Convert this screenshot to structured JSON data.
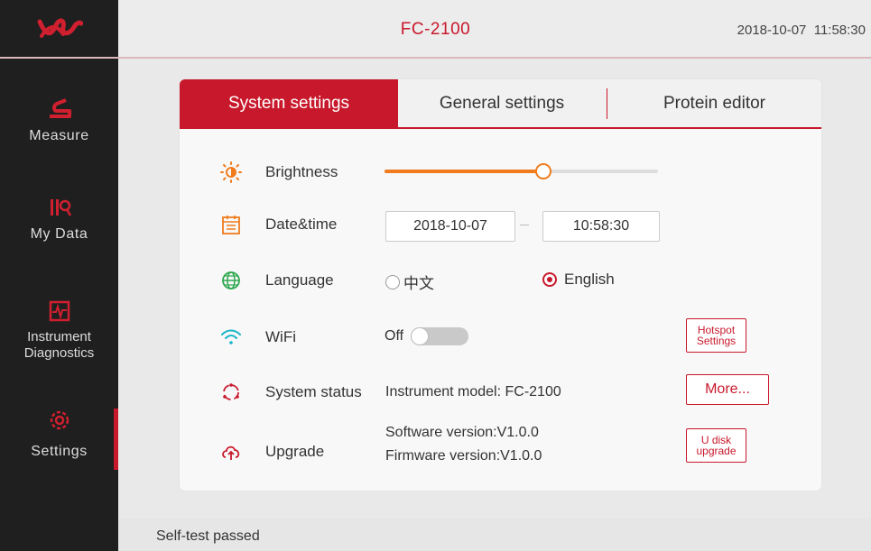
{
  "header": {
    "title": "FC-2100",
    "datetime": "2018-10-07  11:58:30"
  },
  "sidebar": {
    "items": [
      {
        "label": "Measure",
        "icon": "measure-icon"
      },
      {
        "label": "My Data",
        "icon": "my-data-icon"
      },
      {
        "label_line1": "Instrument",
        "label_line2": "Diagnostics",
        "icon": "instrument-diagnostics-icon"
      },
      {
        "label": "Settings",
        "icon": "gear-icon",
        "active": true
      }
    ]
  },
  "tabs": [
    {
      "label": "System settings",
      "active": true
    },
    {
      "label": "General settings"
    },
    {
      "label": "Protein editor"
    }
  ],
  "settings": {
    "brightness": {
      "label": "Brightness",
      "level": 0.58
    },
    "datetime": {
      "label": "Date&time",
      "date": "2018-10-07",
      "time": "10:58:30"
    },
    "language": {
      "label": "Language",
      "option1": "中文",
      "option2": "English",
      "selected": "English"
    },
    "wifi": {
      "label": "WiFi",
      "state": "Off",
      "hotspot_line1": "Hotspot",
      "hotspot_line2": "Settings"
    },
    "system_status": {
      "label": "System status",
      "model": "Instrument model: FC-2100",
      "more": "More..."
    },
    "upgrade": {
      "label": "Upgrade",
      "software": "Software version:V1.0.0",
      "firmware": "Firmware version:V1.0.0",
      "udisk_line1": "U disk",
      "udisk_line2": "upgrade"
    }
  },
  "statusbar": {
    "message": "Self-test passed"
  },
  "colors": {
    "accent": "#c8182b",
    "orange": "#f07c1e",
    "sidebar": "#1f1f1f"
  }
}
